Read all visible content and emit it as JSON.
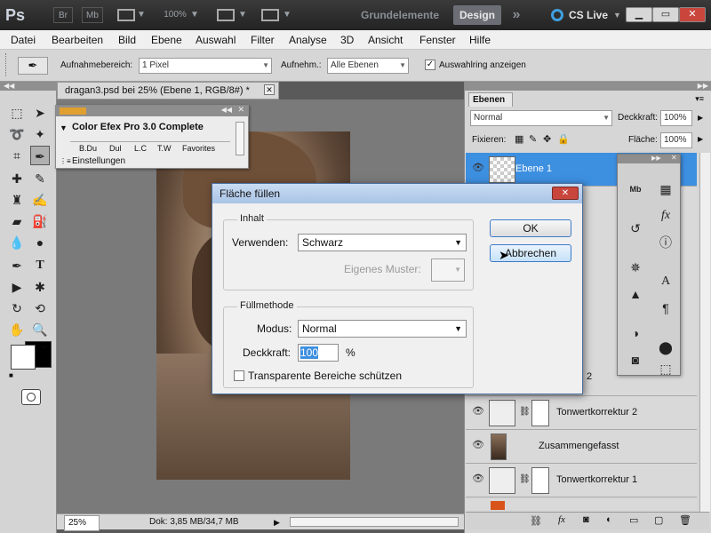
{
  "appbar": {
    "logo": "Ps",
    "br": "Br",
    "mb": "Mb",
    "zoom": "100%",
    "workspaces": [
      "Grundelemente",
      "Design"
    ],
    "more": "»",
    "cslive": "CS Live"
  },
  "menu": [
    "Datei",
    "Bearbeiten",
    "Bild",
    "Ebene",
    "Auswahl",
    "Filter",
    "Analyse",
    "3D",
    "Ansicht",
    "Fenster",
    "Hilfe"
  ],
  "options": {
    "sample_label": "Aufnahmebereich:",
    "sample_value": "1 Pixel",
    "sample2_label": "Aufnehm.:",
    "sample2_value": "Alle Ebenen",
    "ring_label": "Auswahlring anzeigen"
  },
  "document": {
    "tab": "dragan3.psd bei 25% (Ebene 1, RGB/8#) *",
    "zoom": "25%",
    "doc_info": "Dok: 3,85 MB/34,7 MB"
  },
  "color_efex": {
    "title": "Color Efex Pro 3.0 Complete",
    "tabs": [
      "B.Du",
      "Dul",
      "L.C",
      "T.W",
      "Favorites"
    ],
    "footer": "Einstellungen"
  },
  "layers_panel": {
    "tab": "Ebenen",
    "blend": "Normal",
    "opacity_label": "Deckkraft:",
    "opacity": "100%",
    "lock_label": "Fixieren:",
    "fill_label": "Fläche:",
    "fill": "100%",
    "layers": [
      {
        "name": "Ebene 1"
      },
      {
        "name": "Tonwertkorrektur 2"
      },
      {
        "name": "Zusammengefasst"
      },
      {
        "name": "Tonwertkorrektur 1"
      }
    ],
    "partial_r": "r",
    "partial_2": "2"
  },
  "dialog": {
    "title": "Fläche füllen",
    "content_legend": "Inhalt",
    "use_label": "Verwenden:",
    "use_value": "Schwarz",
    "pattern_label": "Eigenes Muster:",
    "blend_legend": "Füllmethode",
    "mode_label": "Modus:",
    "mode_value": "Normal",
    "opacity_label": "Deckkraft:",
    "opacity_value": "100",
    "percent": "%",
    "preserve_label": "Transparente Bereiche schützen",
    "ok": "OK",
    "cancel": "Abbrechen"
  },
  "colors": {
    "selection_blue": "#3d8fe0",
    "dialog_title": "#b7cfee"
  }
}
